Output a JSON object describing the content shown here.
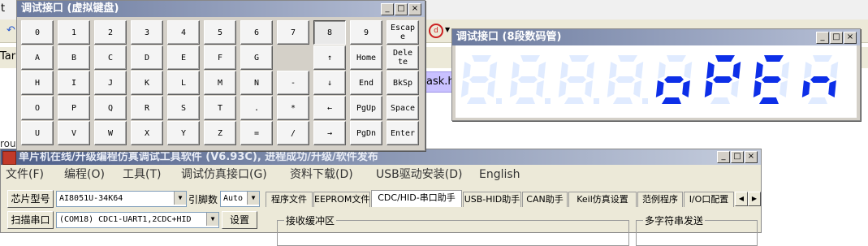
{
  "background": {
    "menu_fragment": "t",
    "toolbar_fragment": "Tar",
    "left_fragment": "rou",
    "file_tab": "ask.h",
    "file_tab_color": "#c9c1ff"
  },
  "keypad": {
    "title": "调试接口 (虚拟键盘)",
    "rows": [
      [
        "0",
        "1",
        "2",
        "3",
        "4",
        "5",
        "6",
        "7",
        "8",
        "9",
        "Escap\ne"
      ],
      [
        "A",
        "B",
        "C",
        "D",
        "E",
        "F",
        "G",
        "↑",
        "Home",
        "Dele\nte"
      ],
      [
        "H",
        "I",
        "J",
        "K",
        "L",
        "M",
        "N",
        "-",
        "↓",
        "End",
        "BkSp"
      ],
      [
        "O",
        "P",
        "Q",
        "R",
        "S",
        "T",
        ".",
        "*",
        "←",
        "PgUp",
        "Space"
      ],
      [
        "U",
        "V",
        "W",
        "X",
        "Y",
        "Z",
        "=",
        "/",
        "→",
        "PgDn",
        "Enter"
      ]
    ],
    "pressed_key": "8"
  },
  "seg_display": {
    "title": "调试接口 (8段数码管)",
    "digits": [
      "8.",
      "8.",
      "8.",
      "8.",
      "o",
      "P",
      "E",
      "n"
    ],
    "lit_text": "oPEn",
    "on_color": "#0d2fe8",
    "off_color": "#e0ebff"
  },
  "window_controls": {
    "minimize": "_",
    "maximize": "□",
    "close": "×"
  },
  "main": {
    "title": "单片机在线/升级编程仿真调试工具软件 (V6.93C), 进程成功/升级/软件发布",
    "menu": [
      "文件(F)",
      "编程(O)",
      "工具(T)",
      "调试仿真接口(G)",
      "资料下载(D)",
      "USB驱动安装(D)",
      "English"
    ],
    "chip_label": "芯片型号",
    "chip_value": "AI8051U-34K64",
    "pins_label": "引脚数",
    "pins_value": "Auto",
    "scan_label": "扫描串口",
    "port_value": "(COM18) CDC1-UART1,2CDC+HID",
    "settings_label": "设置",
    "tabs": [
      "程序文件",
      "EEPROM文件",
      "CDC/HID-串口助手",
      "USB-HID助手",
      "CAN助手",
      "Keil仿真设置",
      "范例程序",
      "I/O口配置"
    ],
    "active_tab": "CDC/HID-串口助手",
    "recv_group": "接收缓冲区",
    "multi_group": "多字符串发送"
  }
}
